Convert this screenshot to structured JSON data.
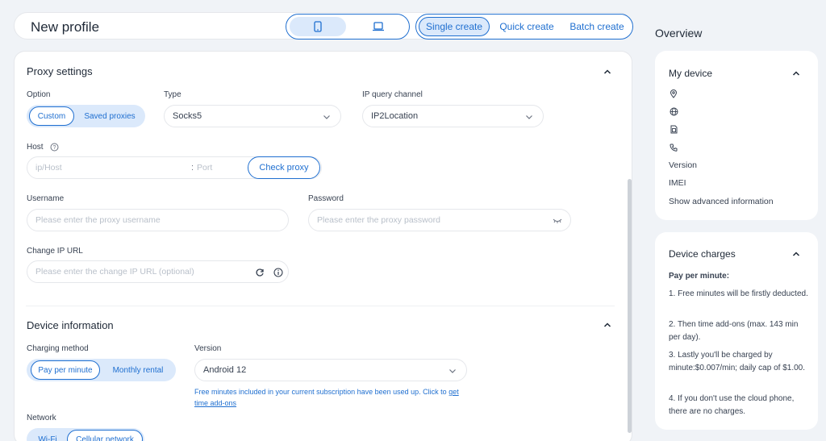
{
  "header": {
    "title": "New profile",
    "mode_tabs": [
      "Single create",
      "Quick create",
      "Batch create"
    ],
    "active_mode": "Single create"
  },
  "proxy": {
    "section_title": "Proxy settings",
    "option_label": "Option",
    "options": [
      "Custom",
      "Saved proxies"
    ],
    "type_label": "Type",
    "type_value": "Socks5",
    "ip_query_label": "IP query channel",
    "ip_query_value": "IP2Location",
    "host_label": "Host",
    "host_placeholder": "ip/Host",
    "port_separator": ":",
    "port_placeholder": "Port",
    "check_button": "Check proxy",
    "username_label": "Username",
    "username_placeholder": "Please enter the proxy username",
    "password_label": "Password",
    "password_placeholder": "Please enter the proxy password",
    "change_ip_label": "Change IP URL",
    "change_ip_placeholder": "Please enter the change IP URL (optional)"
  },
  "device": {
    "section_title": "Device information",
    "charging_label": "Charging method",
    "charging_options": [
      "Pay per minute",
      "Monthly rental"
    ],
    "version_label": "Version",
    "version_value": "Android 12",
    "note_text": "Free minutes included in your current subscription have been used up. Click to",
    "note_link": "get time add-ons",
    "network_label": "Network",
    "network_options": [
      "Wi-Fi",
      "Cellular network"
    ]
  },
  "overview": {
    "title": "Overview",
    "my_device": {
      "title": "My device",
      "icons": [
        "location-pin-icon",
        "globe-icon",
        "sim-card-icon",
        "phone-icon"
      ],
      "version_label": "Version",
      "imei_label": "IMEI",
      "advanced_link": "Show advanced information"
    },
    "charges": {
      "title": "Device charges",
      "heading": "Pay per minute:",
      "items": [
        "1. Free minutes will be firstly deducted.",
        "2. Then time add-ons (max. 143 min per day).",
        "3. Lastly you'll be charged by minute:$0.007/min; daily cap of $1.00.",
        "4. If you don't use the cloud phone, there are no charges."
      ]
    }
  },
  "colors": {
    "accent": "#1f6fd0",
    "accent_light": "#dbe9fb",
    "background": "#f0f3f7"
  }
}
